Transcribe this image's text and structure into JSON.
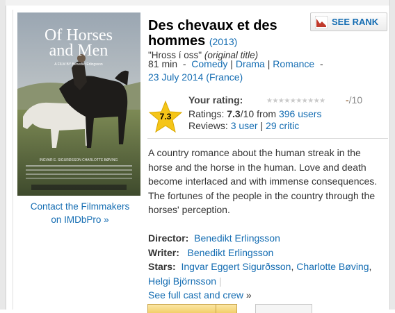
{
  "poster": {
    "title_line1": "Of Horses",
    "title_line2": "and Men",
    "subtitle": "A FILM BY Benedikt Erlingsson",
    "cast_line": "INGVAR E. SIGURÐSSON   CHARLOTTE BØVING"
  },
  "contact": {
    "line1": "Contact the Filmmakers",
    "line2": "on IMDbPro »"
  },
  "rank_button": {
    "label": "SEE RANK"
  },
  "title": {
    "main": "Des chevaux et des hommes",
    "year": "(2013)",
    "original_quoted": "\"Hross í oss\"",
    "original_note": "(original title)"
  },
  "meta": {
    "runtime": "81 min",
    "dash1": "-",
    "genres": [
      "Comedy",
      "Drama",
      "Romance"
    ],
    "pipe": "|",
    "dash2": "-",
    "release": "23 July 2014 (France)"
  },
  "rating": {
    "star_value": "7.3",
    "your_label": "Your rating:",
    "mini_stars": "★★★★★★★★★★",
    "your_value_dash": "-",
    "your_value_out": "/10",
    "ratings_label": "Ratings:",
    "value": "7.3",
    "out_of": "/10 from",
    "users": "396 users",
    "reviews_label": "Reviews:",
    "user_reviews": "3 user",
    "pipe": "|",
    "critic_reviews": "29 critic"
  },
  "plot": "A country romance about the human streak in the horse and the horse in the human. Love and death become interlaced and with immense consequences. The fortunes of the people in the country through the horses' perception.",
  "credits": {
    "director_label": "Director:",
    "director": "Benedikt Erlingsson",
    "writer_label": "Writer:",
    "writer": "Benedikt Erlingsson",
    "stars_label": "Stars:",
    "star1": "Ingvar Eggert Sigurðsson",
    "comma1": ",",
    "star2": "Charlotte Bøving",
    "comma2": ",",
    "star3": "Helgi Björnsson",
    "pipe": "|",
    "full_cast": "See full cast and crew",
    "arrow": "»"
  },
  "colors": {
    "link": "#136cb2",
    "star_gold": "#f5c518",
    "rank_red": "#c0392b"
  },
  "icons": {
    "rank": "trend-chart-icon",
    "rating_star": "star-icon"
  }
}
